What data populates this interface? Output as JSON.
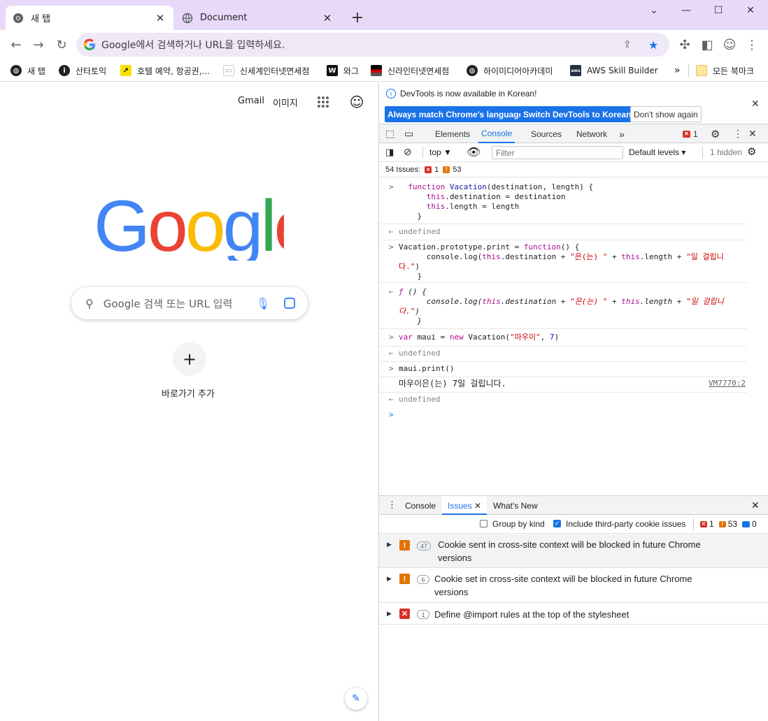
{
  "tabs": [
    {
      "title": "새 탭"
    },
    {
      "title": "Document"
    }
  ],
  "omnibox": {
    "placeholder": "Google에서 검색하거나 URL을 입력하세요."
  },
  "bookmarks": [
    "새 탭",
    "산타토익",
    "호텔 예약, 항공권,...",
    "신세계인터넷면세점",
    "와그",
    "신라인터넷면세점",
    "하이미디어아카데미",
    "AWS Skill Builder"
  ],
  "bookmarks_all": "모든 북마크",
  "ntp": {
    "gmail": "Gmail",
    "images": "이미지",
    "search_placeholder": "Google 검색 또는 URL 입력",
    "shortcut_label": "바로가기 추가"
  },
  "devtools": {
    "info": "DevTools is now available in Korean!",
    "btn_match": "Always match Chrome's language",
    "btn_switch": "Switch DevTools to Korean",
    "btn_dont": "Don't show again",
    "tabs": [
      "Elements",
      "Console",
      "Sources",
      "Network"
    ],
    "error_count": "1",
    "context": "top",
    "filter_placeholder": "Filter",
    "levels": "Default levels",
    "hidden": "1 hidden",
    "issues_label": "54 Issues:",
    "issues_err": "1",
    "issues_warn": "53",
    "console": {
      "undefined": "undefined",
      "log_output": "마우이은(는) 7일 걸립니다.",
      "log_source": "VM7770:2"
    },
    "drawer": {
      "tabs": [
        "Console",
        "Issues",
        "What's New"
      ],
      "group_by_kind": "Group by kind",
      "include_third_party": "Include third-party cookie issues",
      "cnt_err": "1",
      "cnt_warn": "53",
      "cnt_info": "0",
      "issues": [
        {
          "count": "47",
          "text_line1": "Cookie sent in cross-site context will be blocked in future Chrome",
          "text_line2": "versions"
        },
        {
          "count": "6",
          "text_line1": "Cookie set in cross-site context will be blocked in future Chrome",
          "text_line2": "versions"
        },
        {
          "count": "1",
          "text_line1": "Define @import rules at the top of the stylesheet",
          "text_line2": ""
        }
      ]
    }
  }
}
